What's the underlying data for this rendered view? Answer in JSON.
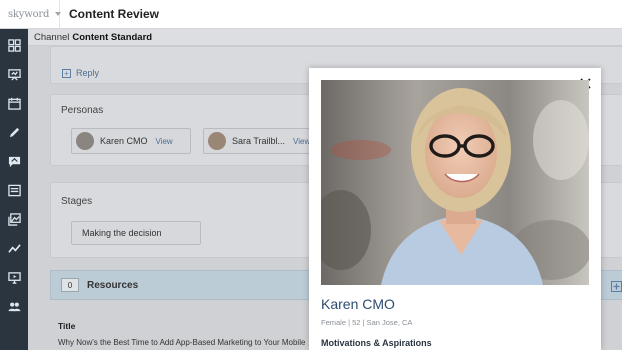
{
  "header": {
    "logo_text": "skyword",
    "title": "Content Review"
  },
  "subheader": {
    "label": "Channel",
    "value": "Content Standard"
  },
  "sidebar": {
    "icons": [
      "grid-icon",
      "presentation-icon",
      "calendar-icon",
      "pencil-icon",
      "comment-icon",
      "document-icon",
      "image-icon",
      "trend-icon",
      "monitor-icon",
      "people-icon"
    ]
  },
  "main": {
    "reply_label": "Reply",
    "personas": {
      "title": "Personas",
      "items": [
        {
          "name": "Karen CMO",
          "view_label": "View"
        },
        {
          "name": "Sara Trailbl...",
          "view_label": "View"
        }
      ]
    },
    "stages": {
      "title": "Stages",
      "value": "Making the decision"
    },
    "resources": {
      "count": "0",
      "label": "Resources"
    },
    "title_field": {
      "label": "Title",
      "value": "Why Now's the Best Time to Add App-Based Marketing to Your Mobile"
    }
  },
  "modal": {
    "close_label": "×",
    "person_name": "Karen CMO",
    "person_meta": "Female  |  52  |  San Jose, CA",
    "section_heading": "Motivations & Aspirations"
  },
  "colors": {
    "sidebar_bg": "#2a3540",
    "accent": "#2f4c71",
    "link": "#4e6f93"
  }
}
